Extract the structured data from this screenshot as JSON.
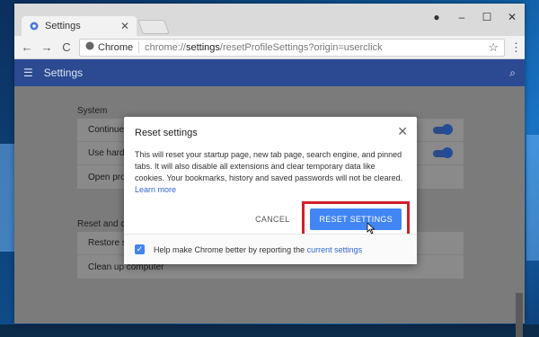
{
  "tab": {
    "title": "Settings",
    "close": "✕"
  },
  "window_controls": {
    "account": "●",
    "minimize": "–",
    "maximize": "☐",
    "close": "✕"
  },
  "toolbar": {
    "back": "←",
    "forward": "→",
    "reload": "C",
    "site_label": "Chrome",
    "url_prefix": "chrome://",
    "url_host": "settings",
    "url_path": "/resetProfileSettings?origin=userclick",
    "star": "☆",
    "menu": "⋮"
  },
  "header": {
    "menu": "☰",
    "title": "Settings",
    "search": "⌕"
  },
  "sections": [
    {
      "label": "System",
      "rows": [
        "Continue ru",
        "Use hardwa",
        "Open proxy"
      ]
    },
    {
      "label": "Reset and clea",
      "rows": [
        "Restore set",
        "Clean up computer"
      ]
    }
  ],
  "dialog": {
    "title": "Reset settings",
    "close": "✕",
    "body": "This will reset your startup page, new tab page, search engine, and pinned tabs. It will also disable all extensions and clear temporary data like cookies. Your bookmarks, history and saved passwords will not be cleared.",
    "learn_more": "Learn more",
    "cancel": "CANCEL",
    "reset": "RESET SETTINGS",
    "footer_text": "Help make Chrome better by reporting the",
    "footer_link": "current settings",
    "checkbox_checked": "✓"
  },
  "colors": {
    "header_bg": "#2b4a92",
    "reset_button": "#4285f4",
    "highlight": "#d0202a",
    "link": "#3367d6"
  }
}
